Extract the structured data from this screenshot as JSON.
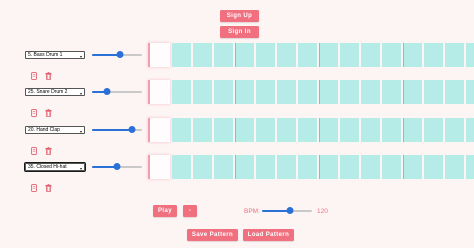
{
  "auth": {
    "signup_label": "Sign Up",
    "signin_label": "Sign In"
  },
  "tracks": [
    {
      "sound": "5. Bass Drum 1",
      "volume": 0.55,
      "focused": false
    },
    {
      "sound": "25. Snare Drum 2",
      "volume": 0.3,
      "focused": false
    },
    {
      "sound": "20. Hand Clap",
      "volume": 0.8,
      "focused": false
    },
    {
      "sound": "35. Closed Hi-hat",
      "volume": 0.5,
      "focused": true
    }
  ],
  "steps_per_track": 16,
  "transport": {
    "play_label": "Play",
    "minus_label": "-",
    "bpm_label": "BPM:",
    "bpm_value": "120",
    "bpm_slider_level": 0.55
  },
  "pattern": {
    "save_label": "Save Pattern",
    "load_label": "Load Pattern"
  },
  "colors": {
    "accent": "#f07080",
    "step_off": "#b5ece8",
    "beat_marker": "#ef8fa0",
    "slider": "#2a70d6"
  },
  "icons": {
    "copy": "copy-icon",
    "delete": "trash-icon"
  }
}
